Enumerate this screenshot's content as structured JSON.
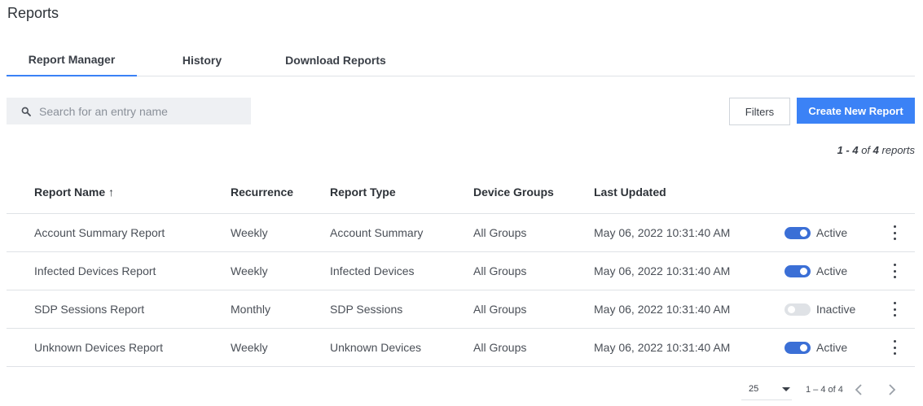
{
  "header": {
    "title": "Reports"
  },
  "tabs": [
    {
      "label": "Report Manager",
      "active": true
    },
    {
      "label": "History",
      "active": false
    },
    {
      "label": "Download Reports",
      "active": false
    }
  ],
  "search": {
    "placeholder": "Search for an entry name",
    "value": ""
  },
  "toolbar": {
    "filters_label": "Filters",
    "create_label": "Create New Report"
  },
  "results": {
    "range": "1 - 4",
    "of_word": "of",
    "total": "4",
    "unit": "reports"
  },
  "table": {
    "columns": [
      "Report Name ↑",
      "Recurrence",
      "Report Type",
      "Device Groups",
      "Last Updated"
    ],
    "rows": [
      {
        "name": "Account Summary Report",
        "recurrence": "Weekly",
        "type": "Account Summary",
        "groups": "All Groups",
        "updated": "May 06, 2022 10:31:40 AM",
        "status": "Active"
      },
      {
        "name": "Infected Devices Report",
        "recurrence": "Weekly",
        "type": "Infected Devices",
        "groups": "All Groups",
        "updated": "May 06, 2022 10:31:40 AM",
        "status": "Active"
      },
      {
        "name": "SDP Sessions Report",
        "recurrence": "Monthly",
        "type": "SDP Sessions",
        "groups": "All Groups",
        "updated": "May 06, 2022 10:31:40 AM",
        "status": "Inactive"
      },
      {
        "name": "Unknown Devices Report",
        "recurrence": "Weekly",
        "type": "Unknown Devices",
        "groups": "All Groups",
        "updated": "May 06, 2022 10:31:40 AM",
        "status": "Active"
      }
    ]
  },
  "pagination": {
    "page_size": "25",
    "range": "1 – 4 of 4"
  },
  "colors": {
    "accent": "#3b82f6",
    "toggle_on": "#3b6fd6",
    "toggle_off": "#dfe2e6",
    "search_bg": "#eef0f3"
  },
  "icons": {
    "search": "search-icon",
    "row_menu": "kebab-menu-icon",
    "prev": "chevron-left-icon",
    "next": "chevron-right-icon",
    "page_size_caret": "caret-down-icon"
  }
}
